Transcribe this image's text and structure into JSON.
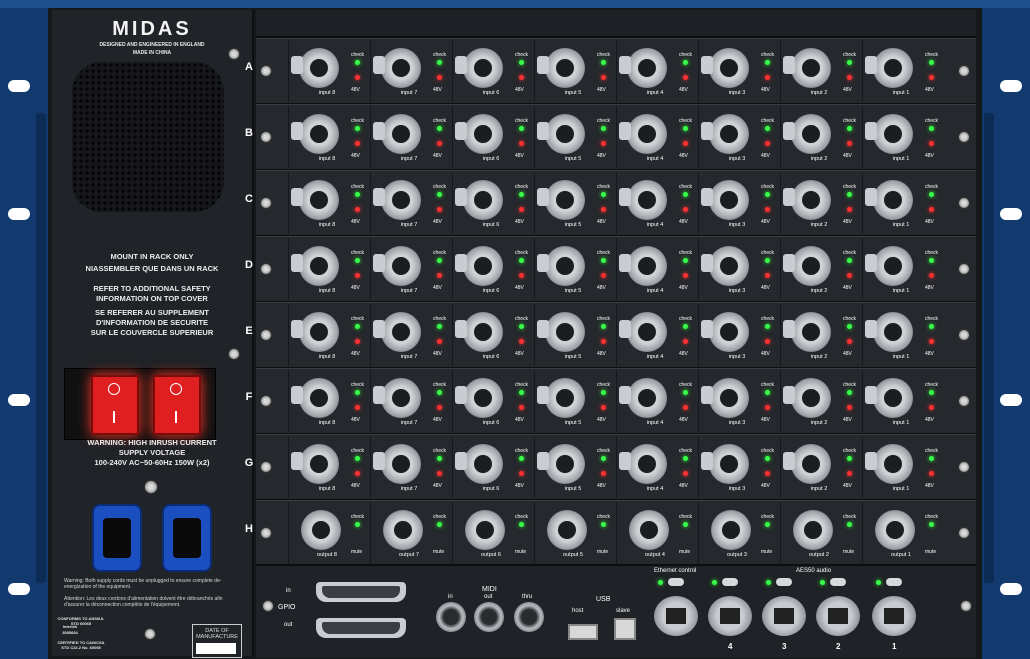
{
  "brand": {
    "logo": "MIDAS",
    "tagline": "DESIGNED AND ENGINEERED IN ENGLAND",
    "made_in": "MADE IN CHINA"
  },
  "psu_panel": {
    "mount_notice_en": "MOUNT IN RACK ONLY",
    "mount_notice_fr": "NIASSEMBLER QUE DANS UN RACK",
    "safety_en_1": "REFER TO ADDITIONAL SAFETY",
    "safety_en_2": "INFORMATION ON TOP COVER",
    "safety_fr_1": "SE REFERER AU SUPPLEMENT",
    "safety_fr_2": "D'INFORMATION DE SECURITE",
    "safety_fr_3": "SUR LE COUVERCLE SUPERIEUR",
    "warning": "WARNING: HIGH INRUSH CURRENT",
    "supply_label": "SUPPLY VOLTAGE",
    "supply_spec": "100-240V  AC~50-60Hz 150W (x2)",
    "unplug_en": "Warning: Both supply cords must be unplugged to ensure complete de-energization of the equipment.",
    "unplug_fr": "Attention: Les deux cordons d'alimentation doivent être débranchés afin d'assurer la déconnection complète de l'équipement.",
    "cert_1": "CONFORMS TO ANSI/UL STD 60065",
    "cert_2": "CERTIFIED TO CAN/CSA STD C22.2 No. 60065",
    "cert_mark": "Intertek",
    "cert_number": "3085664",
    "date_label": "DATE OF MANUFACTURE"
  },
  "rows": [
    "A",
    "B",
    "C",
    "D",
    "E",
    "F",
    "G",
    "H"
  ],
  "input_labels": [
    "input 8",
    "input 7",
    "input 6",
    "input 5",
    "input 4",
    "input 3",
    "input 2",
    "input 1"
  ],
  "output_labels": [
    "output 8",
    "output 7",
    "output 6",
    "output 5",
    "output 4",
    "output 3",
    "output 2",
    "output 1"
  ],
  "led_labels": {
    "check": "check",
    "phantom": "48V",
    "mute": "mute"
  },
  "io_panel": {
    "gpio": "GPIO",
    "gpio_in": "in",
    "gpio_out": "out",
    "midi": "MIDI",
    "midi_in": "in",
    "midi_out": "out",
    "midi_thru": "thru",
    "usb": "USB",
    "usb_host": "host",
    "usb_slave": "slave",
    "ethernet": "Ethernet control",
    "aes50": "AES50 audio",
    "aes_ports": [
      "4",
      "3",
      "2",
      "1"
    ]
  },
  "colors": {
    "power_switch": "#e02020",
    "iec_socket": "#1b4fbf",
    "led_green": "#38ff4a",
    "led_red": "#ff3030"
  }
}
